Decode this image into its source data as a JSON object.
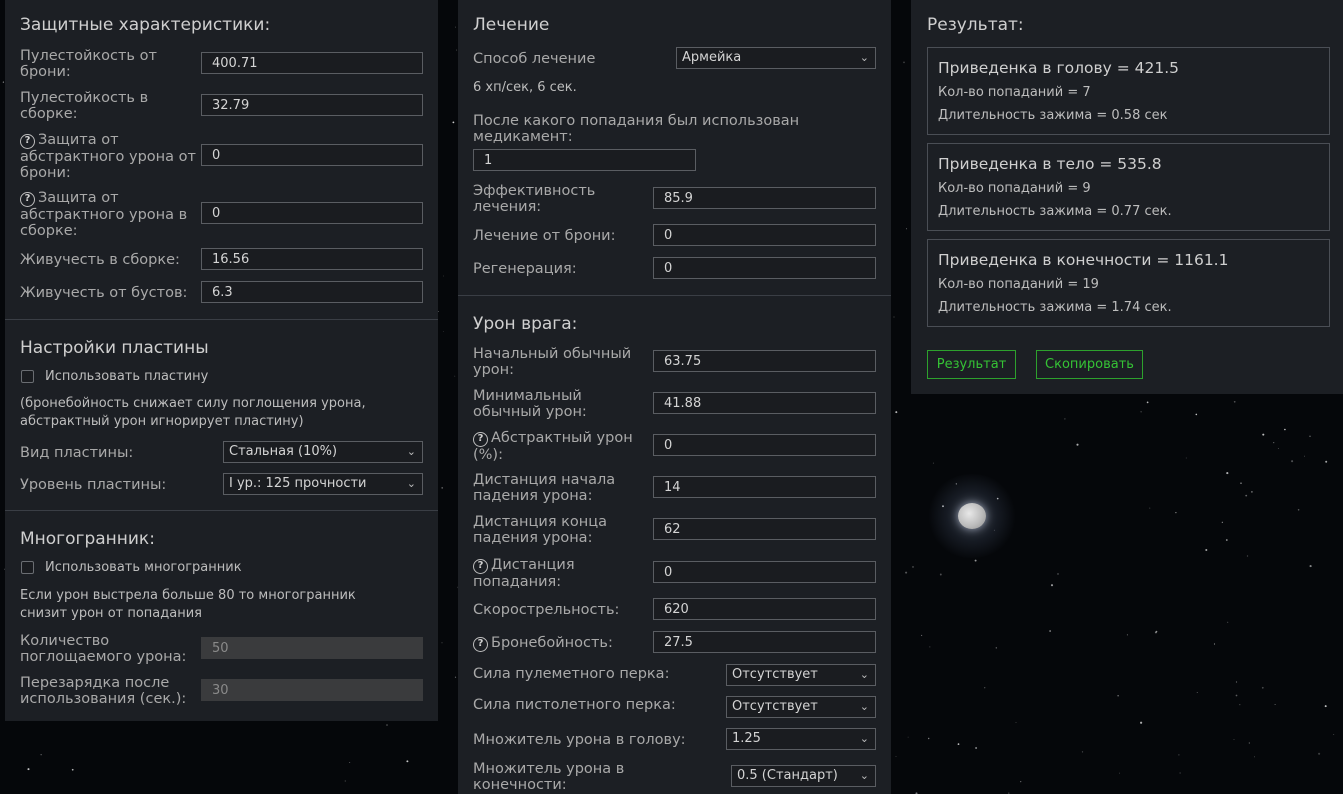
{
  "colors": {
    "background": "#05070a",
    "panel": "#1c1f24",
    "accent_green": "#35c335"
  },
  "defense": {
    "title": "Защитные характеристики:",
    "armor_bullet_label": "Пулестойкость от брони:",
    "armor_bullet_value": "400.71",
    "build_bullet_label": "Пулестойкость в сборке:",
    "build_bullet_value": "32.79",
    "abstract_armor_label": "Защита от абстрактного урона от брони:",
    "abstract_armor_value": "0",
    "abstract_build_label": "Защита от абстрактного урона в сборке:",
    "abstract_build_value": "0",
    "vitality_build_label": "Живучесть в сборке:",
    "vitality_build_value": "16.56",
    "vitality_boost_label": "Живучесть от бустов:",
    "vitality_boost_value": "6.3"
  },
  "plate": {
    "title": "Настройки пластины",
    "use_label": "Использовать пластину",
    "note": "(бронебойность снижает силу поглощения урона, абстрактный урон игнорирует пластину)",
    "type_label": "Вид пластины:",
    "type_value": "Стальная (10%)",
    "level_label": "Уровень пластины:",
    "level_value": "I ур.: 125 прочности"
  },
  "polyhedron": {
    "title": "Многогранник:",
    "use_label": "Использовать многогранник",
    "note": "Если урон выстрела больше 80 то многогранник снизит урон от попадания",
    "absorb_label": "Количество поглощаемого урона:",
    "absorb_value": "50",
    "reload_label": "Перезарядка после использования (сек.):",
    "reload_value": "30"
  },
  "healing": {
    "title": "Лечение",
    "method_label": "Способ лечение",
    "method_value": "Армейка",
    "method_info": "6 хп/сек, 6 сек.",
    "after_hit_label": "После какого попадания был использован медикамент:",
    "after_hit_value": "1",
    "efficiency_label": "Эффективность лечения:",
    "efficiency_value": "85.9",
    "armor_heal_label": "Лечение от брони:",
    "armor_heal_value": "0",
    "regen_label": "Регенерация:",
    "regen_value": "0"
  },
  "enemy": {
    "title": "Урон врага:",
    "start_damage_label": "Начальный обычный урон:",
    "start_damage_value": "63.75",
    "min_damage_label": "Минимальный обычный урон:",
    "min_damage_value": "41.88",
    "abstract_damage_label": "Абстрактный урон (%):",
    "abstract_damage_value": "0",
    "falloff_start_label": "Дистанция начала падения урона:",
    "falloff_start_value": "14",
    "falloff_end_label": "Дистанция конца падения урона:",
    "falloff_end_value": "62",
    "hit_distance_label": "Дистанция попадания:",
    "hit_distance_value": "0",
    "fire_rate_label": "Скорострельность:",
    "fire_rate_value": "620",
    "penetration_label": "Бронебойность:",
    "penetration_value": "27.5",
    "mg_perk_label": "Сила пулеметного перка:",
    "mg_perk_value": "Отсутствует",
    "pistol_perk_label": "Сила пистолетного перка:",
    "pistol_perk_value": "Отсутствует",
    "head_mult_label": "Множитель урона в голову:",
    "head_mult_value": "1.25",
    "limb_mult_label": "Множитель урона в конечности:",
    "limb_mult_value": "0.5 (Стандарт)"
  },
  "result": {
    "title": "Результат:",
    "head": {
      "title": "Приведенка в голову = 421.5",
      "hits": "Кол-во попаданий = 7",
      "hold": "Длительность зажима = 0.58 сек"
    },
    "body": {
      "title": "Приведенка в тело = 535.8",
      "hits": "Кол-во попаданий = 9",
      "hold": "Длительность зажима = 0.77 сек."
    },
    "limbs": {
      "title": "Приведенка в конечности = 1161.1",
      "hits": "Кол-во попаданий = 19",
      "hold": "Длительность зажима = 1.74 сек."
    },
    "result_button": "Результат",
    "copy_button": "Скопировать"
  }
}
